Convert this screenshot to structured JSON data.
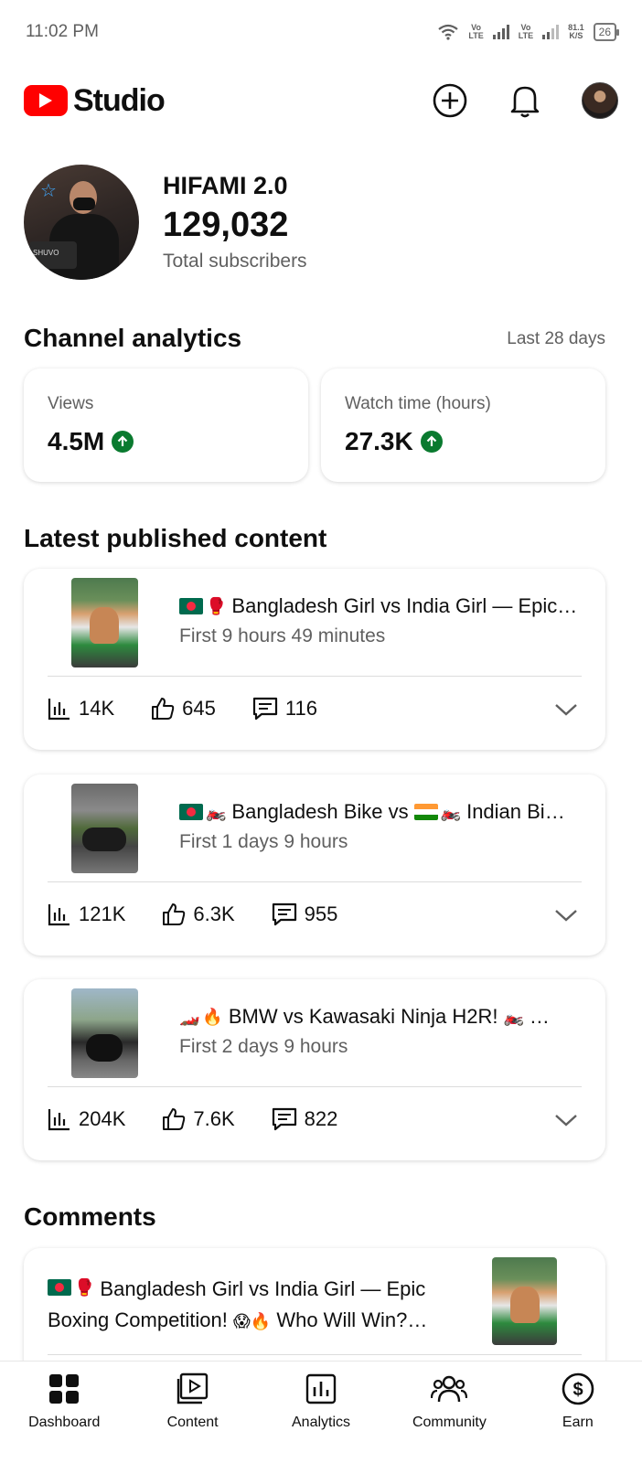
{
  "status_bar": {
    "time": "11:02 PM",
    "net1": "Vo\nLTE",
    "net2": "Vo\nLTE",
    "speed_value": "81.1",
    "speed_unit": "K/S",
    "battery": "26"
  },
  "header": {
    "app_name": "Studio",
    "icons": [
      "create-icon",
      "notifications-icon",
      "account-avatar"
    ]
  },
  "channel": {
    "name": "HIFAMI 2.0",
    "subscribers": "129,032",
    "subscribers_label": "Total subscribers",
    "avatar_text": "SHUVO"
  },
  "analytics": {
    "title": "Channel analytics",
    "range": "Last 28 days",
    "cards": [
      {
        "label": "Views",
        "value": "4.5M",
        "trend": "up"
      },
      {
        "label": "Watch time (hours)",
        "value": "27.3K",
        "trend": "up"
      }
    ]
  },
  "latest": {
    "title": "Latest published content",
    "items": [
      {
        "title": "Bangladesh Girl vs India Girl — Epic…",
        "period": "First 9 hours 49 minutes",
        "views": "14K",
        "likes": "645",
        "comments": "116"
      },
      {
        "title_a": "Bangladesh Bike vs",
        "title_b": "Indian Bi…",
        "period": "First 1 days 9 hours",
        "views": "121K",
        "likes": "6.3K",
        "comments": "955"
      },
      {
        "title": "BMW vs Kawasaki Ninja H2R!",
        "title_tail": "…",
        "period": "First 2 days 9 hours",
        "views": "204K",
        "likes": "7.6K",
        "comments": "822"
      }
    ]
  },
  "comments": {
    "title": "Comments",
    "video_title_a": "Bangladesh Girl vs India Girl — Epic",
    "video_title_b": "Boxing Competition!",
    "video_title_c": "Who Will Win?…"
  },
  "bottom_nav": [
    {
      "label": "Dashboard",
      "icon": "dashboard-icon"
    },
    {
      "label": "Content",
      "icon": "content-icon"
    },
    {
      "label": "Analytics",
      "icon": "analytics-icon"
    },
    {
      "label": "Community",
      "icon": "community-icon"
    },
    {
      "label": "Earn",
      "icon": "earn-icon"
    }
  ],
  "colors": {
    "brand_red": "#ff0000",
    "trend_green": "#0a7a2f",
    "secondary_text": "#606060"
  }
}
